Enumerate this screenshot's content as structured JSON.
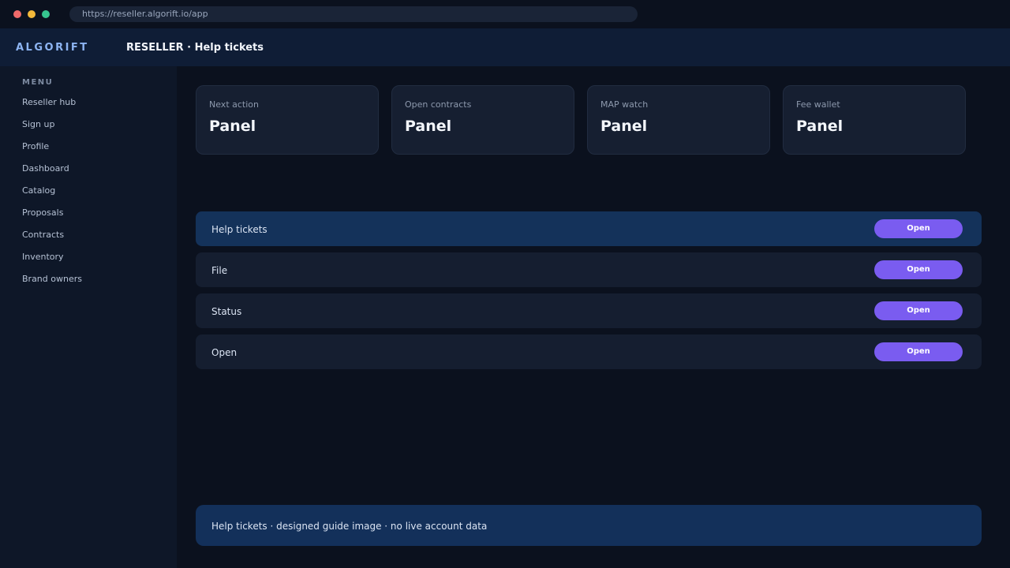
{
  "browser": {
    "url": "https://reseller.algorift.io/app"
  },
  "appbar": {
    "brand": "ALGORIFT",
    "title": "RESELLER · Help tickets"
  },
  "sidebar": {
    "heading": "MENU",
    "items": [
      {
        "label": "Reseller hub"
      },
      {
        "label": "Sign up"
      },
      {
        "label": "Profile"
      },
      {
        "label": "Dashboard"
      },
      {
        "label": "Catalog"
      },
      {
        "label": "Proposals"
      },
      {
        "label": "Contracts"
      },
      {
        "label": "Inventory"
      },
      {
        "label": "Brand owners"
      }
    ]
  },
  "cards": [
    {
      "label": "Next action",
      "value": "Panel"
    },
    {
      "label": "Open contracts",
      "value": "Panel"
    },
    {
      "label": "MAP watch",
      "value": "Panel"
    },
    {
      "label": "Fee wallet",
      "value": "Panel"
    }
  ],
  "rows": [
    {
      "label": "Help tickets",
      "button": "Open"
    },
    {
      "label": "File",
      "button": "Open"
    },
    {
      "label": "Status",
      "button": "Open"
    },
    {
      "label": "Open",
      "button": "Open"
    }
  ],
  "footer": {
    "text": "Help tickets · designed guide image · no live account data"
  },
  "colors": {
    "accent": "#7a5cf0",
    "brand": "#8db4f2",
    "active_row": "#14325a",
    "background": "#0b111e"
  }
}
